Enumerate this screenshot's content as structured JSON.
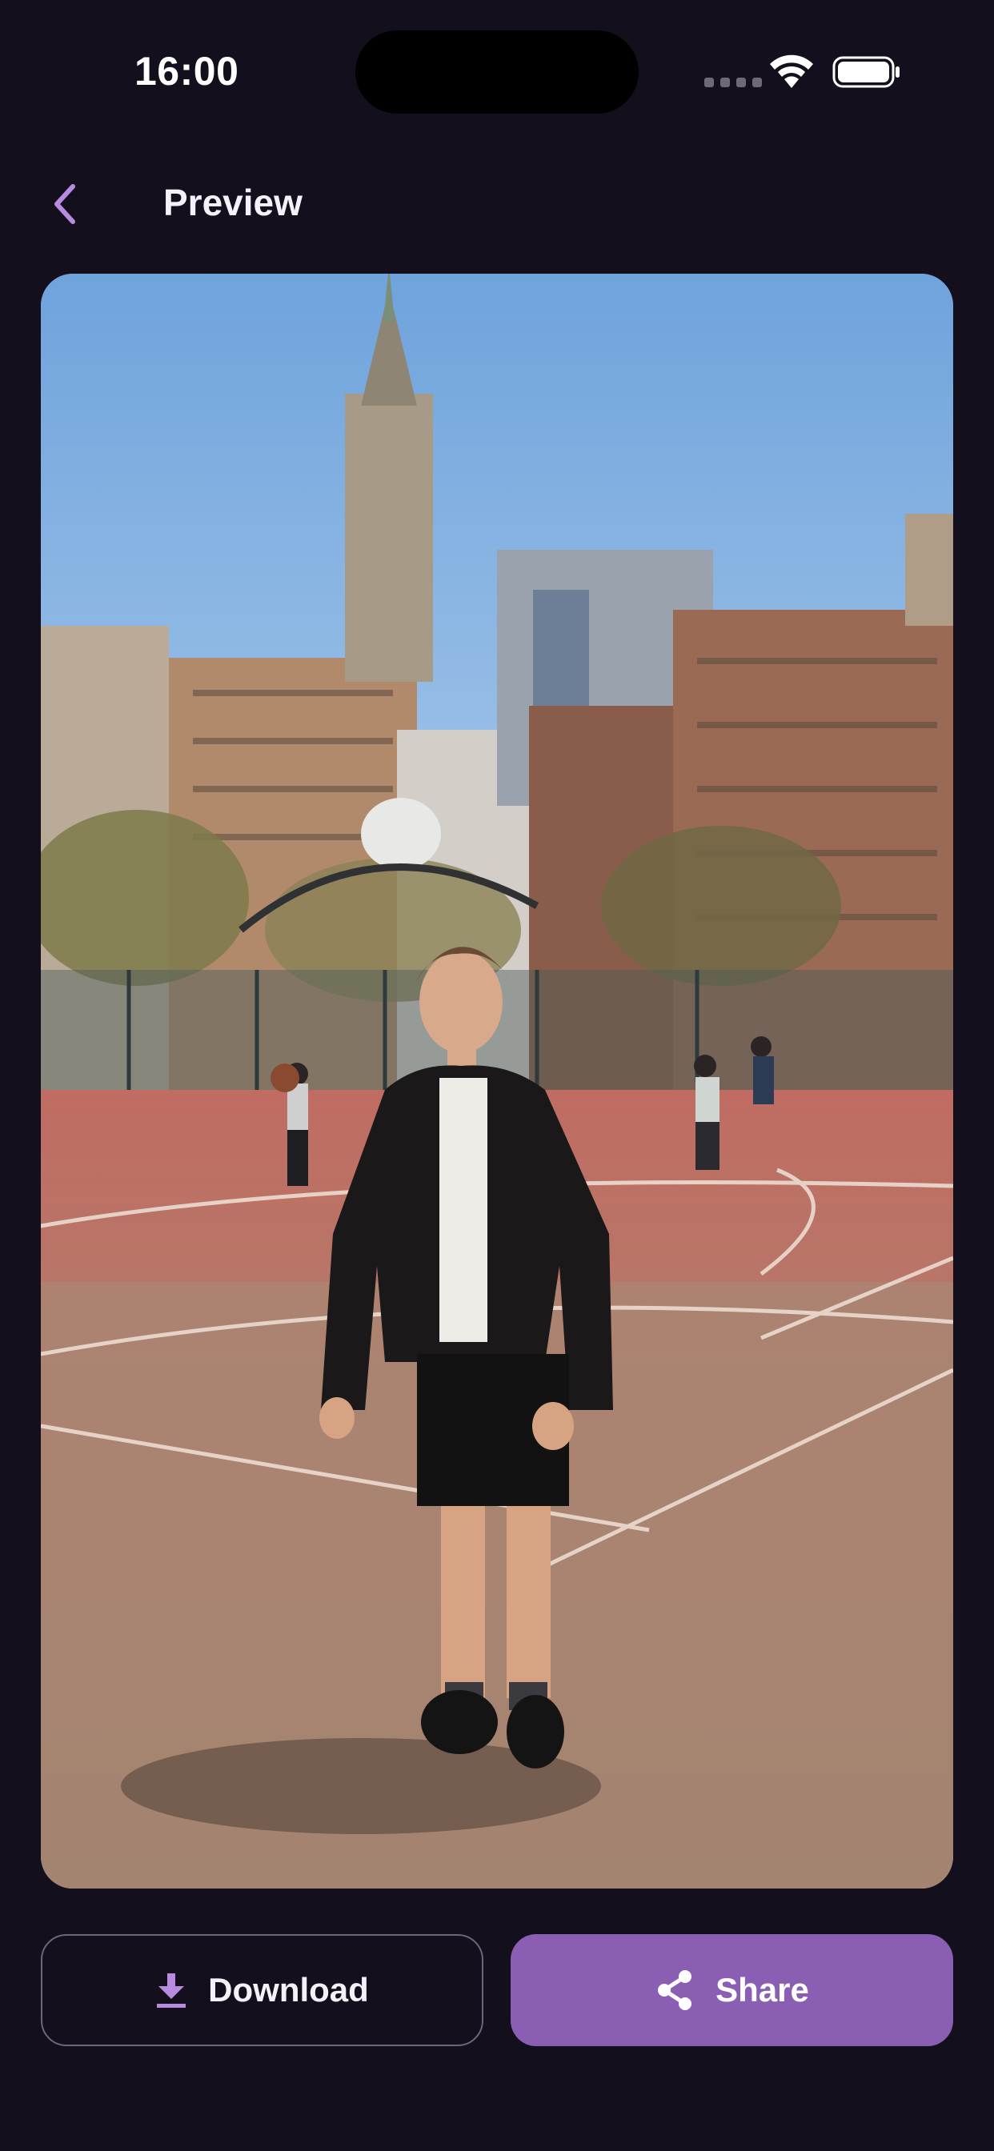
{
  "status_bar": {
    "time": "16:00",
    "icons": [
      "cellular-signal-icon",
      "wifi-icon",
      "battery-icon"
    ]
  },
  "header": {
    "back_icon": "chevron-left-icon",
    "title": "Preview"
  },
  "photo": {
    "subject": "young man in black leather jacket standing on a city basketball court"
  },
  "actions": {
    "download_label": "Download",
    "download_icon": "download-icon",
    "share_label": "Share",
    "share_icon": "share-icon"
  },
  "colors": {
    "background": "#130f1c",
    "accent": "#8a5fb3",
    "icon_accent": "#b98be0",
    "outline": "#6e6678"
  }
}
